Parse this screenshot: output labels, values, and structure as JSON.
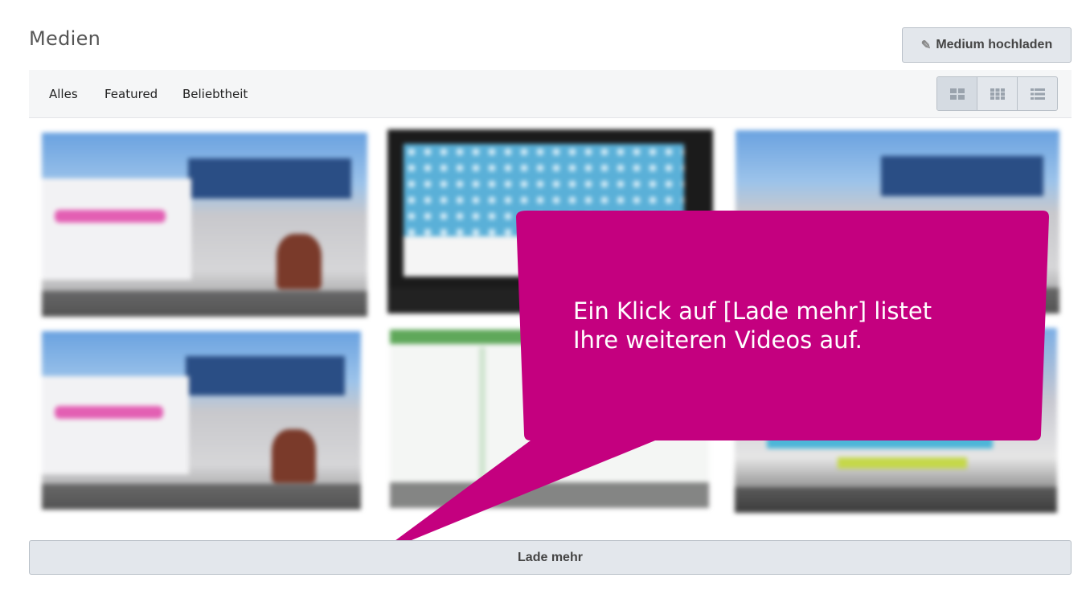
{
  "page": {
    "title": "Medien"
  },
  "toolbar": {
    "upload_label": "Medium hochladen",
    "upload_icon": "pencil-icon"
  },
  "filters": {
    "tabs": [
      {
        "label": "Alles"
      },
      {
        "label": "Featured"
      },
      {
        "label": "Beliebtheit"
      }
    ]
  },
  "view_modes": [
    {
      "icon": "grid-large-icon",
      "active": true
    },
    {
      "icon": "grid-small-icon",
      "active": false
    },
    {
      "icon": "list-view-icon",
      "active": false
    }
  ],
  "callout": {
    "line1": "Ein Klick auf [Lade mehr] listet",
    "line2": "Ihre weiteren Videos auf.",
    "color": "#c4007f"
  },
  "load_more": {
    "label": "Lade mehr"
  }
}
